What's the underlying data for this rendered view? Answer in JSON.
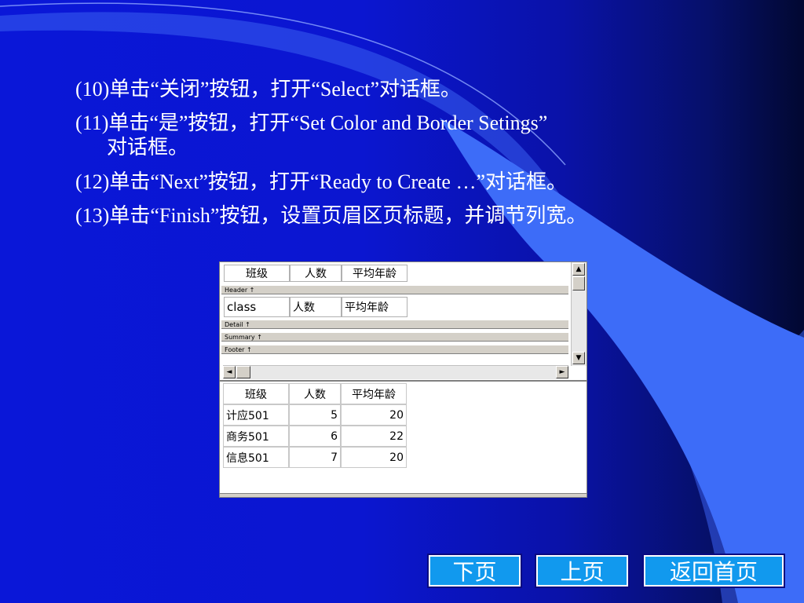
{
  "instructions": [
    {
      "line1": "(10)单击“关闭”按钮，打开“Select”对话框。",
      "line2": ""
    },
    {
      "line1": "(11)单击“是”按钮，打开“Set Color and Border Setings”",
      "line2": "对话框。"
    },
    {
      "line1": "(12)单击“Next”按钮，打开“Ready to Create …”对话框。",
      "line2": ""
    },
    {
      "line1": "(13)单击“Finish”按钮，设置页眉区页标题，并调节列宽。",
      "line2": ""
    }
  ],
  "designer": {
    "header_cells": [
      "班级",
      "人数",
      "平均年龄"
    ],
    "bands": {
      "header": "Header ↑",
      "detail": "Detail ↑",
      "summary": "Summary ↑",
      "footer": "Footer ↑"
    },
    "detail_cells": [
      "class",
      "人数",
      "平均年龄"
    ],
    "scroll_up": "▲",
    "scroll_down": "▼",
    "scroll_left": "◄",
    "scroll_right": "►"
  },
  "preview": {
    "columns": [
      "班级",
      "人数",
      "平均年龄"
    ],
    "rows": [
      [
        "计应501",
        "5",
        "20"
      ],
      [
        "商务501",
        "6",
        "22"
      ],
      [
        "信息501",
        "7",
        "20"
      ]
    ]
  },
  "nav": {
    "next": "下页",
    "prev": "上页",
    "home": "返回首页"
  },
  "colors": {
    "background": "#0a17d8",
    "nav_button": "#1199ee"
  }
}
